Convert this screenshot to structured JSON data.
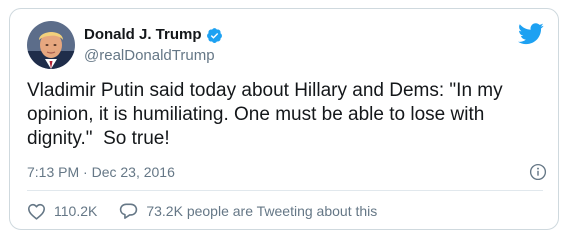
{
  "author": {
    "display_name": "Donald J. Trump",
    "handle": "@realDonaldTrump",
    "verified": true,
    "avatar_icon": "profile-photo"
  },
  "tweet": {
    "text": "Vladimir Putin said today about Hillary and Dems: \"In my opinion, it is humiliating. One must be able to lose with dignity.\"  So true!",
    "timestamp": "7:13 PM · Dec 23, 2016"
  },
  "actions": {
    "likes": "110.2K",
    "replies_text": "73.2K people are Tweeting about this"
  },
  "icons": {
    "brand": "twitter-bird-icon",
    "verified": "verified-badge-icon",
    "info": "info-icon",
    "like": "heart-icon",
    "reply": "speech-bubble-icon"
  },
  "colors": {
    "brand_blue": "#1da1f2",
    "text_primary": "#14171a",
    "text_secondary": "#657786",
    "border": "#cfd9de"
  }
}
